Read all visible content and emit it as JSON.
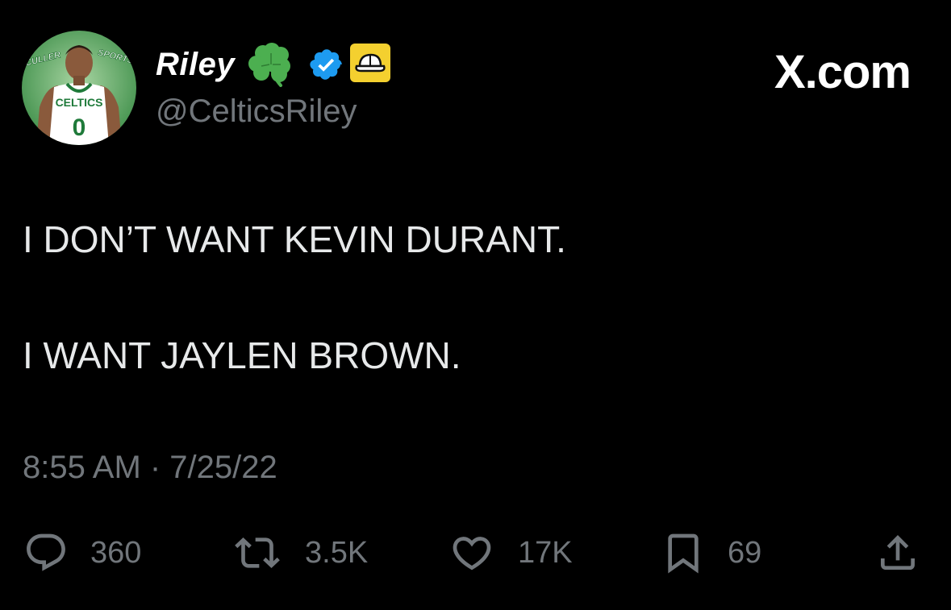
{
  "user": {
    "display_name": "Riley",
    "handle": "@CelticsRiley",
    "badges": [
      "shamrock-icon",
      "verified-icon",
      "cap-icon"
    ],
    "avatar": {
      "jersey_text": "CELTICS",
      "jersey_number": "0",
      "logo_left": "CULLER",
      "logo_right": "SPORTS"
    }
  },
  "site_logo": "X.com",
  "tweet": {
    "lines": [
      "I DON’T WANT KEVIN DURANT.",
      "I WANT JAYLEN BROWN."
    ],
    "timestamp": "8:55 AM · 7/25/22"
  },
  "actions": {
    "replies": "360",
    "retweets": "3.5K",
    "likes": "17K",
    "bookmarks": "69"
  },
  "colors": {
    "background": "#000000",
    "text": "#e7e9ea",
    "muted": "#71767b",
    "verified": "#1d9bf0",
    "shamrock": "#4caf50",
    "cap_badge": "#f4d02f"
  }
}
